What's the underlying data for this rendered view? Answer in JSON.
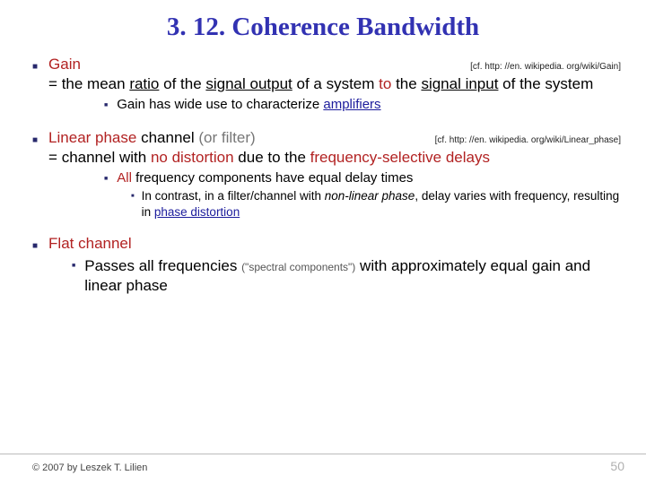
{
  "title": "3. 12. Coherence Bandwidth",
  "items": [
    {
      "head": "Gain",
      "ref": "[cf. http: //en. wikipedia. org/wiki/Gain]",
      "body_pre": "= the mean ",
      "body_ratio": "ratio",
      "body_mid1": " of the ",
      "body_sigout": "signal output",
      "body_mid2": " of a system ",
      "body_to": "to",
      "body_mid3": " the ",
      "body_sigin": "signal input",
      "body_post": " of the system",
      "sub_pre": "Gain has wide use to characterize ",
      "sub_amp": "amplifiers"
    },
    {
      "head1": "Linear phase",
      "head2": " channel ",
      "head3": "(or filter)",
      "ref": "[cf.  http: //en. wikipedia. org/wiki/Linear_phase]",
      "body_pre": "= channel with ",
      "body_nd": "no distortion",
      "body_mid": " due to the ",
      "body_fsd": "frequency-selective delays",
      "sub2_pre": "All",
      "sub2_post": " frequency components have equal delay times",
      "sub3_pre": "In contrast, in a filter/channel with ",
      "sub3_nlp": "non-linear phase",
      "sub3_mid": ", delay varies with frequency, resulting in ",
      "sub3_pd": "phase distortion"
    },
    {
      "head": "Flat channel",
      "sub_pre": "Passes all frequencies ",
      "sub_paren": "(\"spectral components\")",
      "sub_post": " with approxi­mately equal gain and linear phase"
    }
  ],
  "footer": {
    "copyright": "© 2007 by Leszek T. Lilien",
    "page": "50"
  }
}
